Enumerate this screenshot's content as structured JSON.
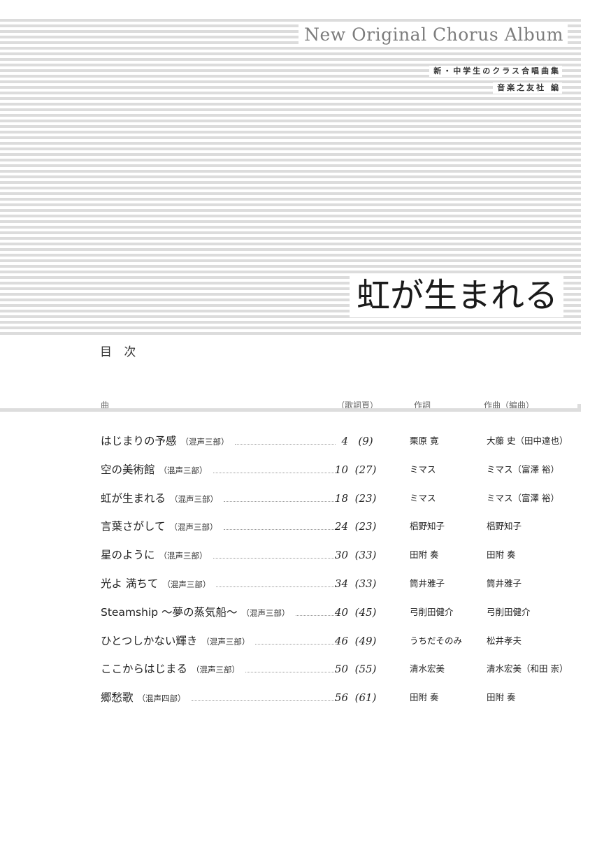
{
  "header": {
    "series_title": "New Original Chorus Album",
    "subtitle_line1": "新・中学生のクラス合唱曲集",
    "subtitle_line2": "音楽之友社 編",
    "album_title": "虹が生まれる"
  },
  "toc": {
    "heading": "目 次",
    "columns": {
      "song": "曲",
      "lyrics_page": "（歌詞頁）",
      "lyricist": "作詞",
      "composer": "作曲（編曲）"
    },
    "entries": [
      {
        "title": "はじまりの予感",
        "voicing": "（混声三部）",
        "page": "4",
        "lyrics_page": "(9)",
        "lyricist": "栗原 寛",
        "composer": "大藤 史（田中達也）"
      },
      {
        "title": "空の美術館",
        "voicing": "（混声三部）",
        "page": "10",
        "lyrics_page": "(27)",
        "lyricist": "ミマス",
        "composer": "ミマス（富澤 裕）"
      },
      {
        "title": "虹が生まれる",
        "voicing": "（混声三部）",
        "page": "18",
        "lyrics_page": "(23)",
        "lyricist": "ミマス",
        "composer": "ミマス（富澤 裕）"
      },
      {
        "title": "言葉さがして",
        "voicing": "（混声三部）",
        "page": "24",
        "lyrics_page": "(23)",
        "lyricist": "梠野知子",
        "composer": "梠野知子"
      },
      {
        "title": "星のように",
        "voicing": "（混声三部）",
        "page": "30",
        "lyrics_page": "(33)",
        "lyricist": "田附 奏",
        "composer": "田附 奏"
      },
      {
        "title": "光よ 満ちて",
        "voicing": "（混声三部）",
        "page": "34",
        "lyrics_page": "(33)",
        "lyricist": "筒井雅子",
        "composer": "筒井雅子"
      },
      {
        "title": "Steamship ～夢の蒸気船～",
        "voicing": "（混声三部）",
        "page": "40",
        "lyrics_page": "(45)",
        "lyricist": "弓削田健介",
        "composer": "弓削田健介"
      },
      {
        "title": "ひとつしかない輝き",
        "voicing": "（混声三部）",
        "page": "46",
        "lyrics_page": "(49)",
        "lyricist": "うちだそのみ",
        "composer": "松井孝夫"
      },
      {
        "title": "ここからはじまる",
        "voicing": "（混声三部）",
        "page": "50",
        "lyrics_page": "(55)",
        "lyricist": "清水宏美",
        "composer": "清水宏美（和田 崇）"
      },
      {
        "title": "郷愁歌",
        "voicing": "（混声四部）",
        "page": "56",
        "lyrics_page": "(61)",
        "lyricist": "田附 奏",
        "composer": "田附 奏"
      }
    ]
  }
}
